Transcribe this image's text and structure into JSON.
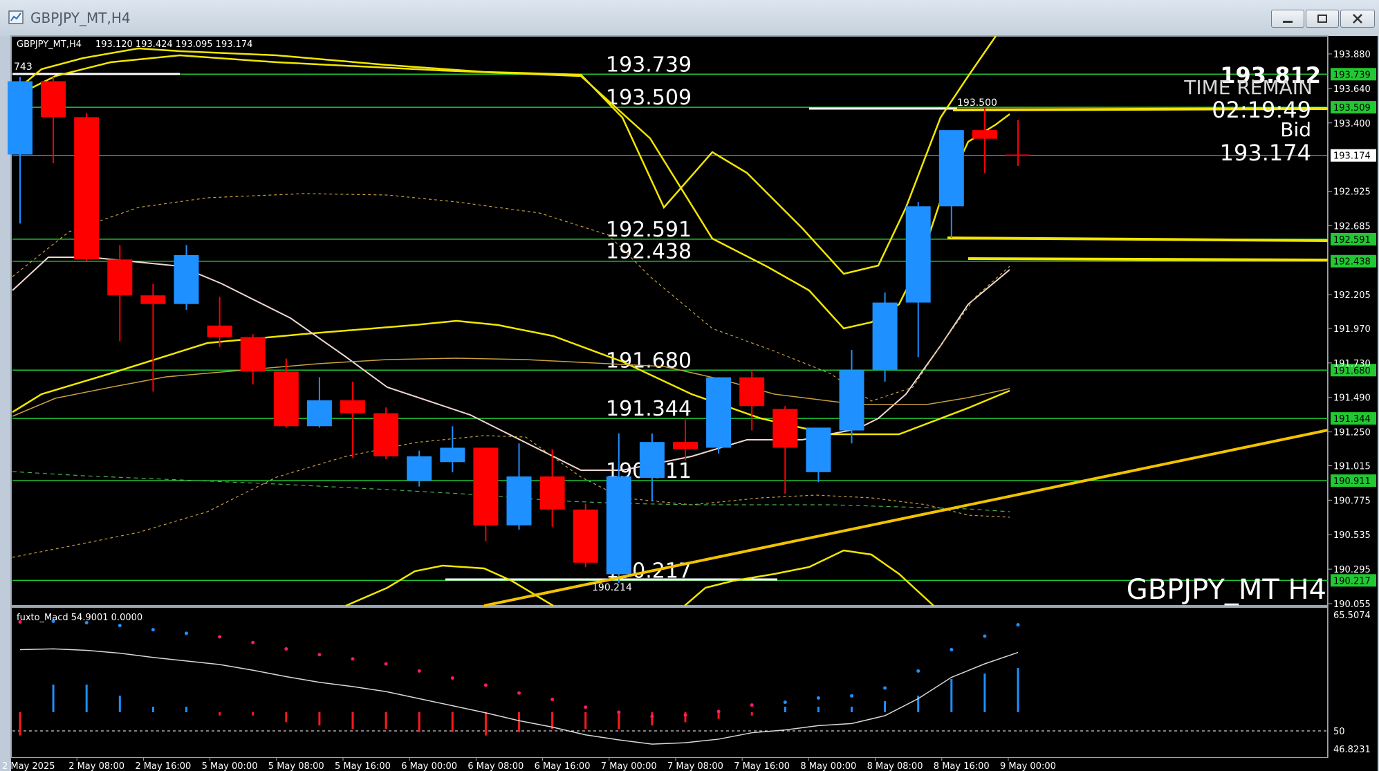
{
  "window": {
    "title": "GBPJPY_MT,H4"
  },
  "chart_data": {
    "type": "candlestick",
    "symbol_label": "GBPJPY_MT,H4",
    "ohlc_header": "193.120 193.424 193.095 193.174",
    "watermark": "GBPJPY_MT H4",
    "price_axis_ticks": [
      "193.880",
      "193.640",
      "193.400",
      "192.925",
      "192.685",
      "192.205",
      "191.970",
      "191.730",
      "191.490",
      "191.250",
      "191.015",
      "190.775",
      "190.535",
      "190.295",
      "190.055"
    ],
    "time_axis_labels": [
      "2 May 2025",
      "2 May 08:00",
      "2 May 16:00",
      "5 May 00:00",
      "5 May 08:00",
      "5 May 16:00",
      "6 May 00:00",
      "6 May 08:00",
      "6 May 16:00",
      "7 May 00:00",
      "7 May 08:00",
      "7 May 16:00",
      "8 May 00:00",
      "8 May 08:00",
      "8 May 16:00",
      "9 May 00:00"
    ],
    "horizontal_levels": [
      {
        "label": "193.739",
        "tag": "193.739"
      },
      {
        "label": "193.509",
        "tag": "193.509"
      },
      {
        "label": "192.591",
        "tag": "192.591"
      },
      {
        "label": "192.438",
        "tag": "192.438"
      },
      {
        "label": "191.680",
        "tag": "191.680"
      },
      {
        "label": "191.344",
        "tag": "191.344"
      },
      {
        "label": "190.911",
        "tag": "190.911"
      },
      {
        "label": "190.217",
        "tag": "190.217"
      }
    ],
    "current_price": "193.174",
    "info_panel": {
      "price": "193.812",
      "time_remain_label": "TIME REMAIN",
      "countdown": "02:19:49",
      "bid_label": "Bid",
      "bid": "193.174"
    },
    "marker_labels": {
      "left_stub": "743",
      "high_mark": "193.500",
      "low_mark": "190.214"
    },
    "candles": [
      {
        "o": 193.18,
        "h": 193.72,
        "l": 192.7,
        "c": 193.69
      },
      {
        "o": 193.69,
        "h": 193.72,
        "l": 193.12,
        "c": 193.44
      },
      {
        "o": 193.44,
        "h": 193.47,
        "l": 192.44,
        "c": 192.45
      },
      {
        "o": 192.45,
        "h": 192.55,
        "l": 191.88,
        "c": 192.2
      },
      {
        "o": 192.2,
        "h": 192.28,
        "l": 191.53,
        "c": 192.14
      },
      {
        "o": 192.14,
        "h": 192.55,
        "l": 192.1,
        "c": 192.48
      },
      {
        "o": 191.99,
        "h": 192.19,
        "l": 191.84,
        "c": 191.91
      },
      {
        "o": 191.91,
        "h": 191.93,
        "l": 191.58,
        "c": 191.67
      },
      {
        "o": 191.67,
        "h": 191.76,
        "l": 191.28,
        "c": 191.29
      },
      {
        "o": 191.29,
        "h": 191.63,
        "l": 191.28,
        "c": 191.47
      },
      {
        "o": 191.47,
        "h": 191.6,
        "l": 191.07,
        "c": 191.38
      },
      {
        "o": 191.38,
        "h": 191.42,
        "l": 191.06,
        "c": 191.08
      },
      {
        "o": 190.91,
        "h": 191.12,
        "l": 190.87,
        "c": 191.08
      },
      {
        "o": 191.04,
        "h": 191.29,
        "l": 190.97,
        "c": 191.14
      },
      {
        "o": 191.14,
        "h": 191.14,
        "l": 190.49,
        "c": 190.6
      },
      {
        "o": 190.6,
        "h": 191.17,
        "l": 190.57,
        "c": 190.94
      },
      {
        "o": 190.94,
        "h": 191.13,
        "l": 190.59,
        "c": 190.71
      },
      {
        "o": 190.71,
        "h": 190.75,
        "l": 190.31,
        "c": 190.34
      },
      {
        "o": 190.26,
        "h": 191.24,
        "l": 190.2,
        "c": 190.94
      },
      {
        "o": 190.93,
        "h": 191.24,
        "l": 190.77,
        "c": 191.18
      },
      {
        "o": 191.18,
        "h": 191.35,
        "l": 191.05,
        "c": 191.13
      },
      {
        "o": 191.14,
        "h": 191.63,
        "l": 191.1,
        "c": 191.63
      },
      {
        "o": 191.63,
        "h": 191.68,
        "l": 191.26,
        "c": 191.43
      },
      {
        "o": 191.41,
        "h": 191.43,
        "l": 190.82,
        "c": 191.14
      },
      {
        "o": 190.97,
        "h": 191.26,
        "l": 190.9,
        "c": 191.28
      },
      {
        "o": 191.26,
        "h": 191.82,
        "l": 191.17,
        "c": 191.68
      },
      {
        "o": 191.68,
        "h": 192.22,
        "l": 191.6,
        "c": 192.15
      },
      {
        "o": 192.15,
        "h": 192.85,
        "l": 191.77,
        "c": 192.82
      },
      {
        "o": 192.82,
        "h": 193.24,
        "l": 192.6,
        "c": 193.35
      },
      {
        "o": 193.35,
        "h": 193.5,
        "l": 193.05,
        "c": 193.29
      },
      {
        "o": 193.18,
        "h": 193.42,
        "l": 193.1,
        "c": 193.17
      }
    ],
    "indicator": {
      "label": "fuxto_Macd 54.9001  0.0000",
      "axis_ticks": [
        "65.5074",
        "50",
        "46.8231"
      ],
      "histogram": [
        -0.7,
        0.5,
        0.5,
        0.3,
        0.1,
        0.1,
        -0.1,
        -0.1,
        -0.3,
        -0.4,
        -0.5,
        -0.5,
        -0.6,
        -0.6,
        -0.7,
        -0.6,
        -0.5,
        -0.5,
        -0.5,
        -0.4,
        -0.3,
        -0.2,
        -0.1,
        0.1,
        0.1,
        0.1,
        0.2,
        0.3,
        0.6,
        0.7,
        0.8
      ],
      "line": [
        60.5,
        60.6,
        60.4,
        60.0,
        59.4,
        58.9,
        58.4,
        57.6,
        56.7,
        55.9,
        55.3,
        54.6,
        53.6,
        52.6,
        51.6,
        50.5,
        49.6,
        48.5,
        47.8,
        47.2,
        47.4,
        47.9,
        48.8,
        49.2,
        49.8,
        50.1,
        51.2,
        53.6,
        56.6,
        58.5,
        60.1
      ]
    }
  }
}
